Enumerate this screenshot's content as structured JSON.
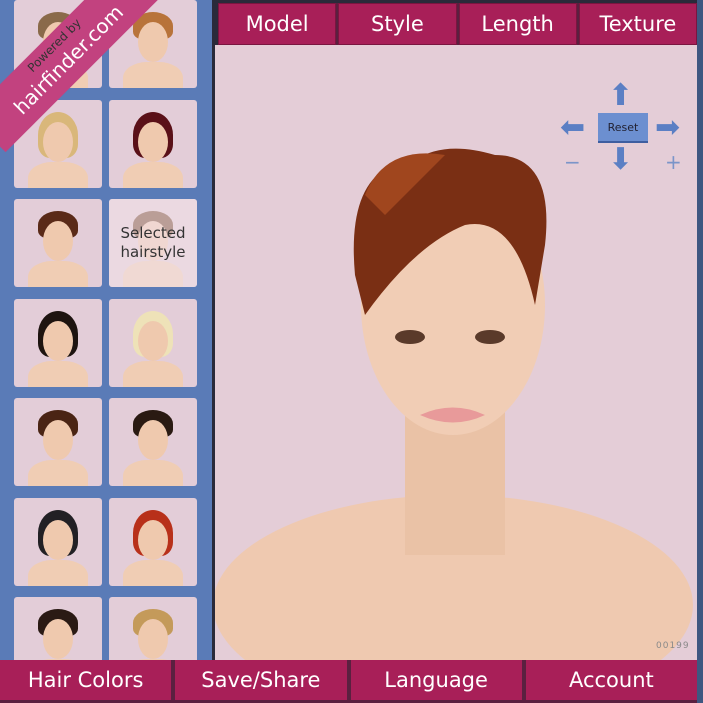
{
  "branding": {
    "line1": "Powered by",
    "line2": "hairfinder.com"
  },
  "top_tabs": [
    {
      "label": "Model"
    },
    {
      "label": "Style"
    },
    {
      "label": "Length"
    },
    {
      "label": "Texture"
    }
  ],
  "bottom_tabs": [
    {
      "label": "Hair Colors"
    },
    {
      "label": "Save/Share"
    },
    {
      "label": "Language"
    },
    {
      "label": "Account"
    }
  ],
  "controls": {
    "reset_label": "Reset",
    "zoom_out": "−",
    "zoom_in": "+",
    "arrow_up": "⬆",
    "arrow_down": "⬇",
    "arrow_left": "⬅",
    "arrow_right": "➡"
  },
  "selected_overlay": "Selected hairstyle",
  "image_code": "00199",
  "thumbnails": [
    {
      "hair": "#8a6a4a"
    },
    {
      "hair": "#b8733a"
    },
    {
      "hair": "#d9b77a"
    },
    {
      "hair": "#5a1018"
    },
    {
      "hair": "#5a2a18"
    },
    {
      "hair": "#6a3a20"
    },
    {
      "hair": "#1e1410"
    },
    {
      "hair": "#eee2b8"
    },
    {
      "hair": "#4a2414"
    },
    {
      "hair": "#2a1a12"
    },
    {
      "hair": "#222024"
    },
    {
      "hair": "#b8301a"
    },
    {
      "hair": "#2a1a14"
    },
    {
      "hair": "#c49a5a"
    }
  ],
  "colors": {
    "tab": "#a81f58",
    "sidebar": "#5a7bb7",
    "canvas": "#e4cdd7",
    "ribbon": "#c2427f"
  }
}
